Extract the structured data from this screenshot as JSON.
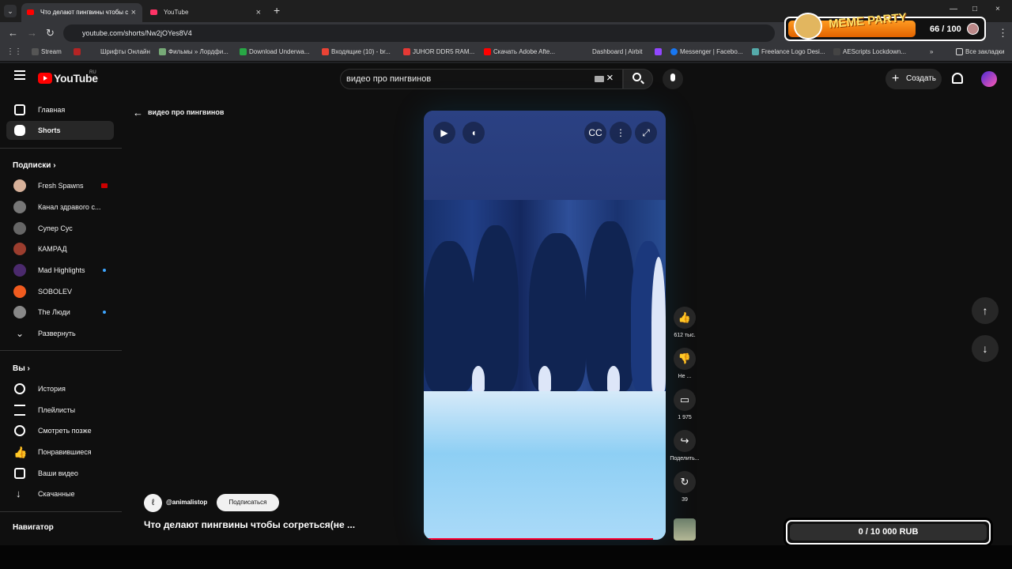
{
  "browser": {
    "tabs": [
      {
        "title": "Что делают пингвины чтобы с"
      },
      {
        "title": "YouTube"
      }
    ],
    "url": "youtube.com/shorts/Nw2jOYes8V4",
    "bookmarks": [
      "Stream",
      "Шрифты Онлайн",
      "Фильмы » Лордфи...",
      "Download Underwa...",
      "Входящие (10) - br...",
      "JUHOR DDR5 RAM...",
      "Скачать Adobe Afte...",
      "Dashboard | Airbit",
      "Messenger | Facebo...",
      "Freelance Logo Desi...",
      "AEScripts Lockdown...",
      "Все закладки"
    ]
  },
  "overlay": {
    "meme_party": "MEME PARTY",
    "count": "66 / 100",
    "rub": "0 / 10 000 RUB"
  },
  "youtube": {
    "logo": "YouTube",
    "region": "RU",
    "search": "видео про пингвинов",
    "create": "Создать",
    "back_query": "видео про пингвинов"
  },
  "sidebar": {
    "main": [
      {
        "label": "Главная"
      },
      {
        "label": "Shorts"
      }
    ],
    "subscriptions_title": "Подписки",
    "subscriptions": [
      {
        "label": "Fresh Spawns"
      },
      {
        "label": "Канал здравого с..."
      },
      {
        "label": "Супер Сус"
      },
      {
        "label": "КАМРАД"
      },
      {
        "label": "Mad Highlights"
      },
      {
        "label": "SOBOLEV"
      },
      {
        "label": "The Люди"
      },
      {
        "label": "Развернуть"
      }
    ],
    "you_title": "Вы",
    "you": [
      {
        "label": "История"
      },
      {
        "label": "Плейлисты"
      },
      {
        "label": "Смотреть позже"
      },
      {
        "label": "Понравившиеся"
      },
      {
        "label": "Ваши видео"
      },
      {
        "label": "Скачанные"
      }
    ],
    "navigator_title": "Навигатор"
  },
  "short": {
    "channel": "@animalistop",
    "subscribe": "Подписаться",
    "title": "Что делают пингвины чтобы согреться(не ...",
    "likes": "612 тыс.",
    "dislike": "Не ...",
    "comments": "1 975",
    "share": "Поделить...",
    "remix": "39"
  },
  "colors": {
    "accent": "#ff0000",
    "background": "#0f0f0f",
    "progress": "#ff0033"
  }
}
